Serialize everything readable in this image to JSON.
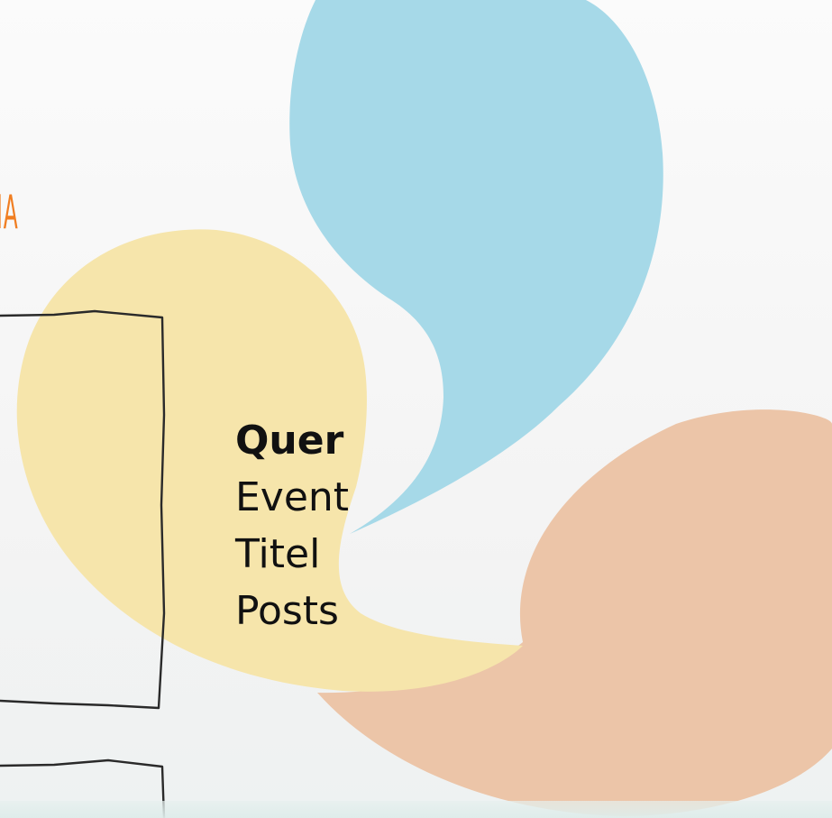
{
  "heading": {
    "text": "IA"
  },
  "menu": {
    "items": [
      {
        "label": "Quer",
        "active": true
      },
      {
        "label": "Event",
        "active": false
      },
      {
        "label": "Titel",
        "active": false
      },
      {
        "label": "Posts",
        "active": false
      }
    ]
  },
  "colors": {
    "heading_orange": "#f07e22",
    "blob_blue": "#a6d9e8",
    "blob_yellow": "#f6e5ab",
    "blob_peach": "#ecc5a8",
    "sketch_line": "#2a2a2a"
  }
}
